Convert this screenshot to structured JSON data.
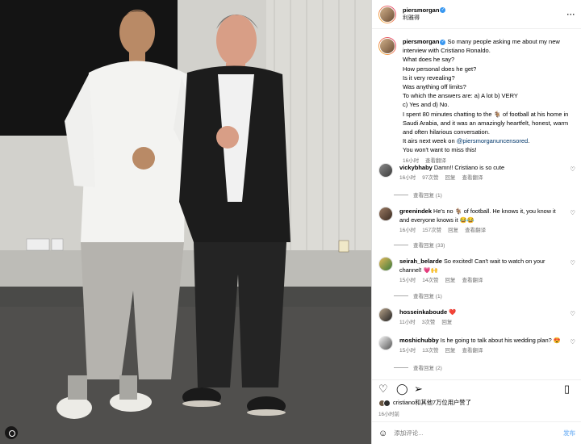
{
  "header": {
    "username": "piersmorgan",
    "subtitle": "利雅得"
  },
  "caption": {
    "username": "piersmorgan",
    "lines": [
      "So many people asking me about my new interview with Cristiano Ronaldo.",
      "What does he say?",
      "How personal does he get?",
      "Is it very revealing?",
      "Was anything off limits?",
      "To which the answers are: a) A lot b) VERY",
      "c) Yes and d) No.",
      "I spent 80 minutes chatting to the 🐐 of football at his home in Saudi Arabia, and it was an amazingly heartfelt, honest, warm and often hilarious conversation."
    ],
    "airs_prefix": "It airs next week on",
    "airs_link": "@piersmorganuncensored",
    "airs_suffix": ".",
    "closing": "You won't want to miss this!",
    "time": "16小时",
    "translate": "查看翻译"
  },
  "comments": [
    {
      "username": "vickybhaby",
      "text": "Damn!! Cristiano is so cute",
      "time": "16小时",
      "likes": "97次赞",
      "reply": "回复",
      "translate": "查看翻译",
      "replies": "查看回复 (1)"
    },
    {
      "username": "greenindek",
      "text": "He's no 🐐 of football. He knows it, you know it and everyone knows it 😂😂",
      "time": "16小时",
      "likes": "157次赞",
      "reply": "回复",
      "translate": "查看翻译",
      "replies": "查看回复 (33)"
    },
    {
      "username": "seirah_belarde",
      "text": "So excited! Can't wait to watch on your channel! 💗🙌",
      "time": "15小时",
      "likes": "14次赞",
      "reply": "回复",
      "translate": "查看翻译",
      "replies": "查看回复 (1)"
    },
    {
      "username": "hosseinkaboude",
      "text": "❤️",
      "time": "11小时",
      "likes": "3次赞",
      "reply": "回复",
      "translate": "",
      "replies": ""
    },
    {
      "username": "moshichubby",
      "text": "Is he going to talk about his wedding plan? 😍",
      "time": "15小时",
      "likes": "13次赞",
      "reply": "回复",
      "translate": "查看翻译",
      "replies": "查看回复 (2)"
    }
  ],
  "likes_text": "cristiano和其他7万位用户赞了",
  "post_time": "16小时前",
  "comment_input": {
    "placeholder": "添加评论...",
    "post_label": "发布"
  },
  "icons": [
    "heart-icon",
    "comment-icon",
    "share-icon",
    "bookmark-icon",
    "more-icon",
    "emoji-icon",
    "carousel-icon"
  ],
  "colors": {
    "link": "#00376b",
    "verified": "#3897f0",
    "post_button": "#8ec1f7"
  }
}
